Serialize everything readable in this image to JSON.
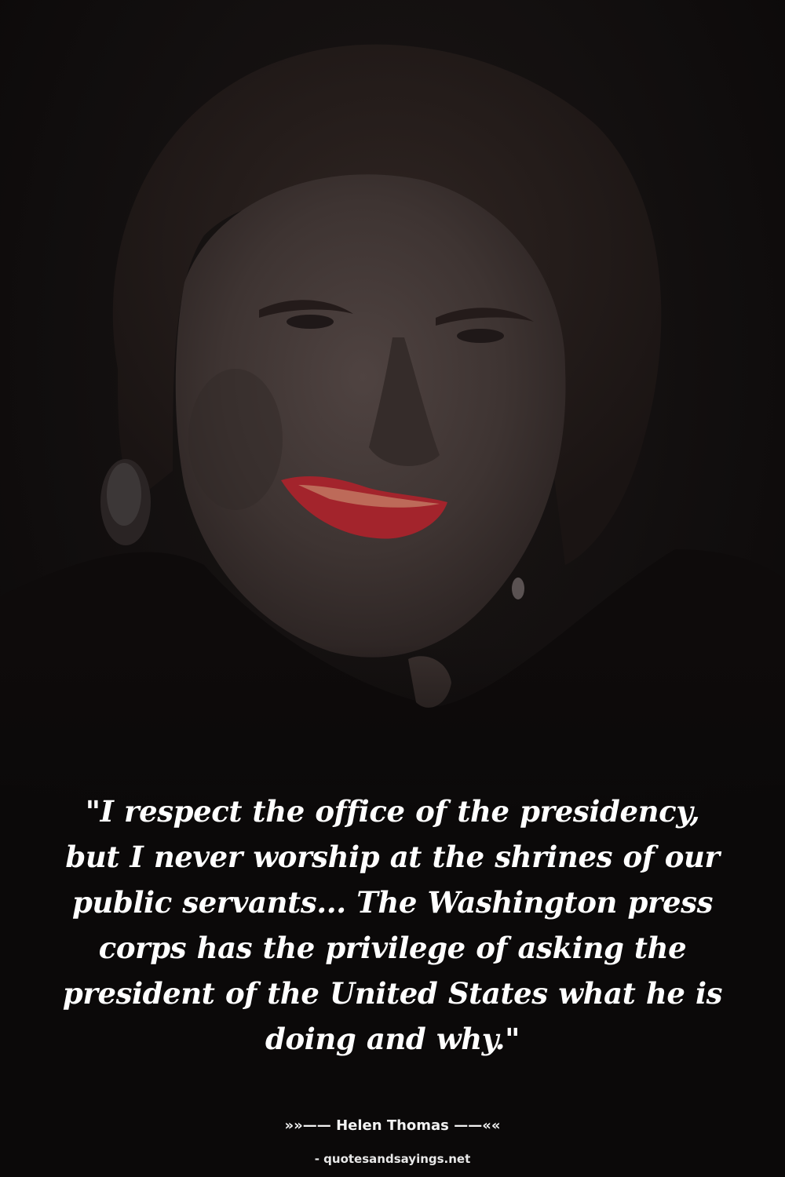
{
  "quote": {
    "text": "\"I respect the office of the presidency, but I never worship at the shrines of our public servants... The Washington press corps has the privilege of asking the president of the United States what he is doing and why.\""
  },
  "author": {
    "prefix": "»»——",
    "name": "Helen Thomas",
    "suffix": "——««"
  },
  "source": {
    "text": "- quotesandsayings.net"
  },
  "colors": {
    "background": "#0b0909",
    "text": "#ffffff",
    "lips": "#a3242c"
  }
}
